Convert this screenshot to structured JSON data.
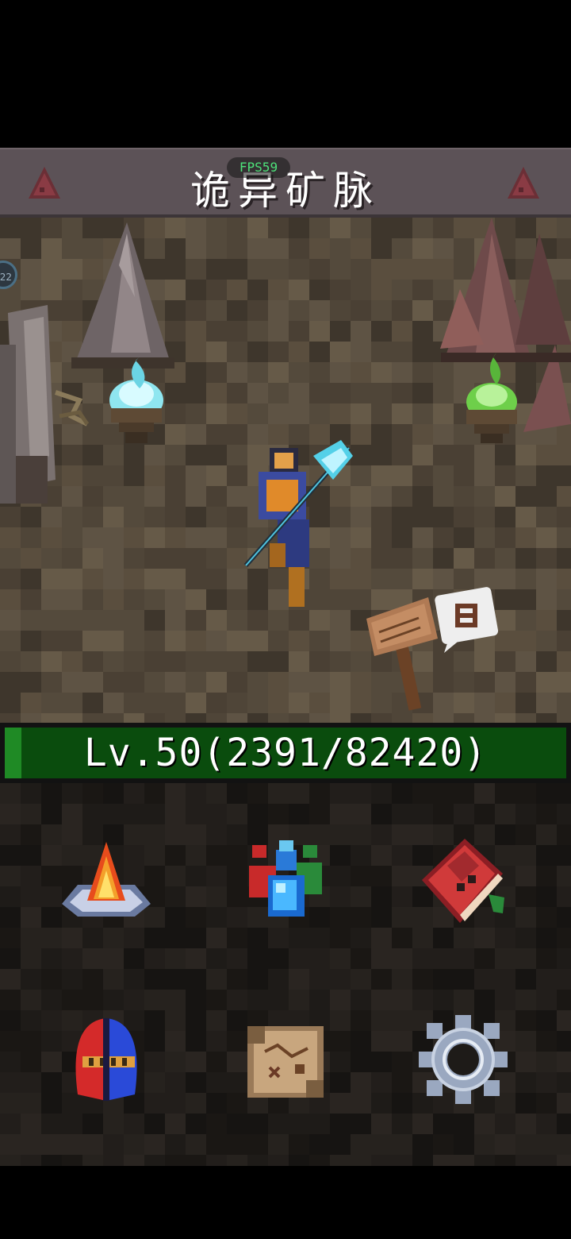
{
  "title_bar": {
    "title": "诡异矿脉",
    "fps_label": "FPS59"
  },
  "progress": {
    "level_text": "Lv.50(2391/82420)",
    "xp_current": 2391,
    "xp_max": 82420
  },
  "game": {
    "side_badge_text": "22"
  },
  "menu": {
    "items": [
      {
        "name": "campfire",
        "icon": "campfire-icon"
      },
      {
        "name": "potions",
        "icon": "potion-icon"
      },
      {
        "name": "spellbook",
        "icon": "book-icon"
      },
      {
        "name": "equipment",
        "icon": "helmet-icon"
      },
      {
        "name": "map",
        "icon": "map-icon"
      },
      {
        "name": "settings",
        "icon": "gear-icon"
      }
    ]
  },
  "colors": {
    "level_bar": "#0a4c0d",
    "level_fill": "#1f8a25",
    "fps_text": "#4de27a"
  }
}
